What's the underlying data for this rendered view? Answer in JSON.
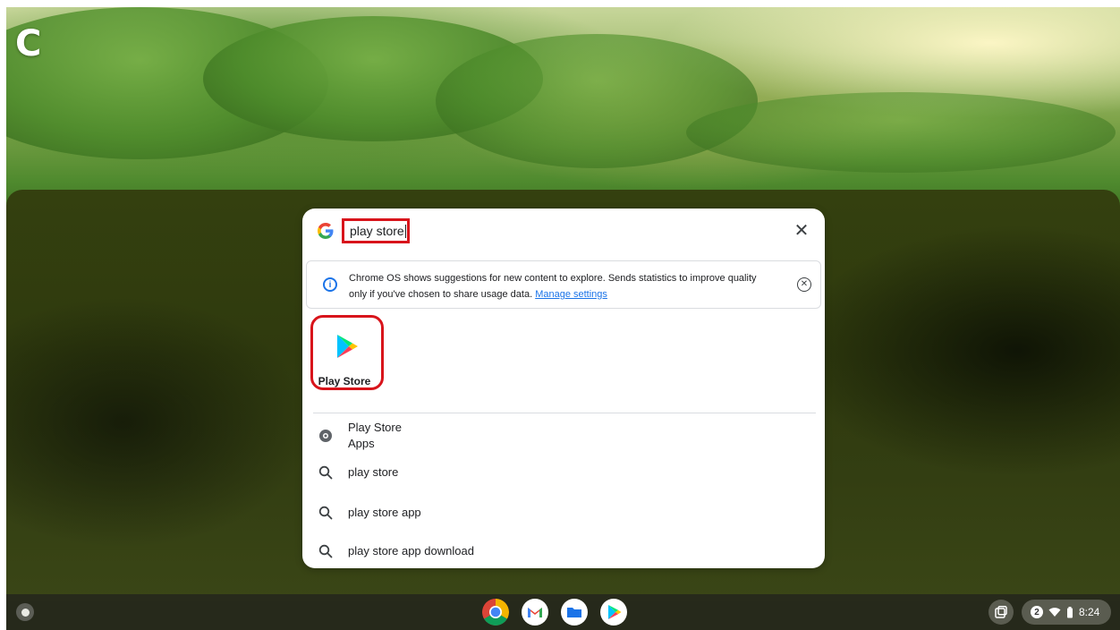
{
  "desktop": {
    "corner_letter": "C"
  },
  "search": {
    "query": "play store",
    "close_icon": "close-icon"
  },
  "privacy_notice": {
    "text_line1": "Chrome OS shows suggestions for new content to explore. Sends statistics to improve quality",
    "text_line2": "only if you've chosen to share usage data.",
    "link_label": "Manage settings"
  },
  "app_result": {
    "label": "Play Store",
    "icon": "play-store-icon"
  },
  "results": [
    {
      "type": "app",
      "title": "Play Store",
      "subtitle": "Apps",
      "icon": "settings-gear-icon"
    },
    {
      "type": "search",
      "title": "play store",
      "icon": "search-icon"
    },
    {
      "type": "search",
      "title": "play store app",
      "icon": "search-icon"
    },
    {
      "type": "search",
      "title": "play store app download",
      "icon": "search-icon"
    }
  ],
  "shelf": {
    "apps": [
      "chrome-icon",
      "gmail-icon",
      "files-icon",
      "play-store-icon"
    ],
    "notification_count": "2",
    "time": "8:24"
  },
  "colors": {
    "highlight": "#d8141b",
    "link": "#1a73e8"
  }
}
